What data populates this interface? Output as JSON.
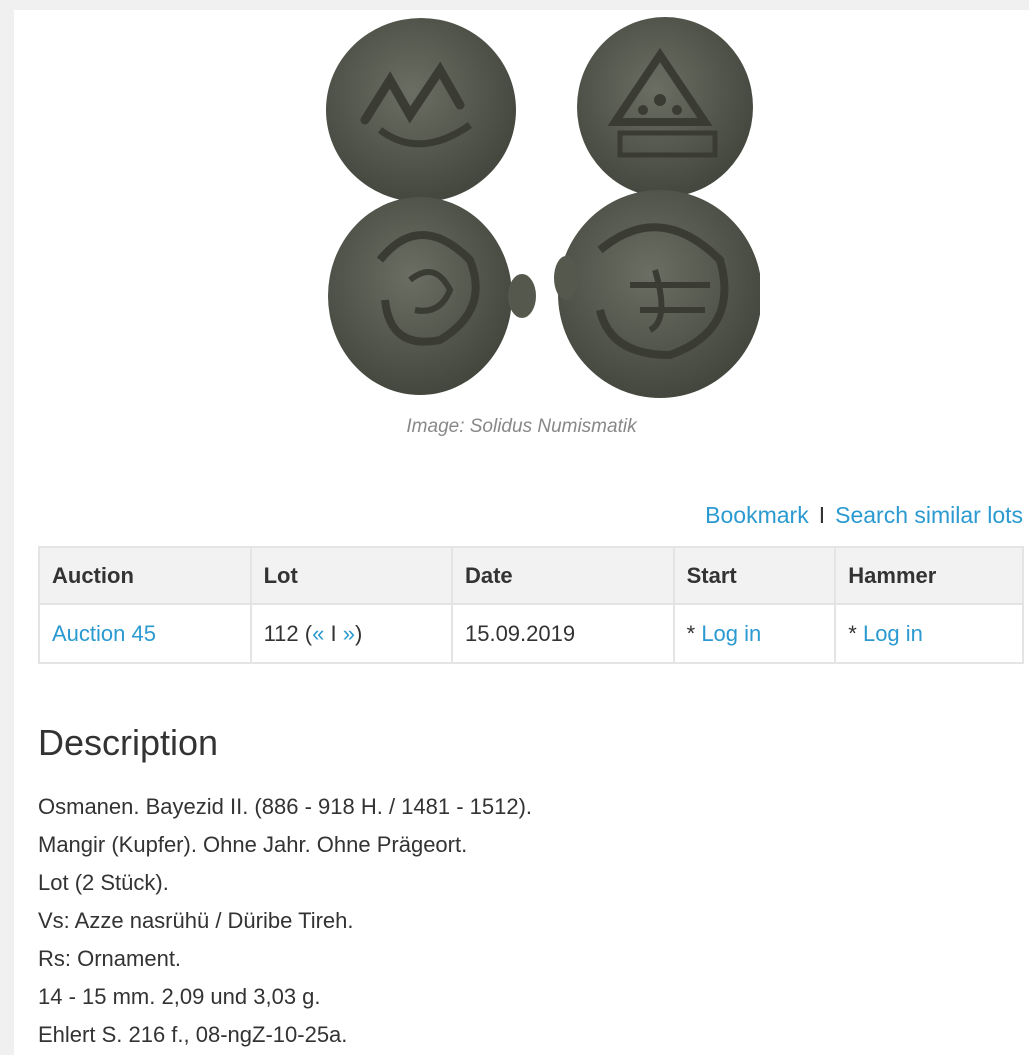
{
  "image": {
    "caption": "Image: Solidus Numismatik",
    "coin_color": "#5c5f54"
  },
  "actions": {
    "bookmark": "Bookmark",
    "separator": "I",
    "search_similar": "Search similar lots"
  },
  "table": {
    "headers": [
      "Auction",
      "Lot",
      "Date",
      "Start",
      "Hammer"
    ],
    "row": {
      "auction": "Auction 45",
      "lot_number": "112",
      "lot_open": " (",
      "lot_prev": "«",
      "lot_sep": " I ",
      "lot_next": "»",
      "lot_close": ")",
      "date": "15.09.2019",
      "start_prefix": "* ",
      "start_link": "Log in",
      "hammer_prefix": "* ",
      "hammer_link": "Log in"
    }
  },
  "description": {
    "title": "Description",
    "lines": [
      "Osmanen. Bayezid II. (886 - 918 H. / 1481 - 1512).",
      "Mangir (Kupfer). Ohne Jahr. Ohne Prägeort.",
      "Lot (2 Stück).",
      "Vs: Azze nasrühü / Düribe Tireh.",
      "Rs: Ornament.",
      "14 - 15 mm. 2,09 und 3,03 g.",
      "Ehlert S. 216 f., 08-ngZ-10-25a."
    ]
  },
  "colors": {
    "link": "#2a9ad0",
    "header_bg": "#f2f2f2",
    "border": "#e4e4e4"
  }
}
